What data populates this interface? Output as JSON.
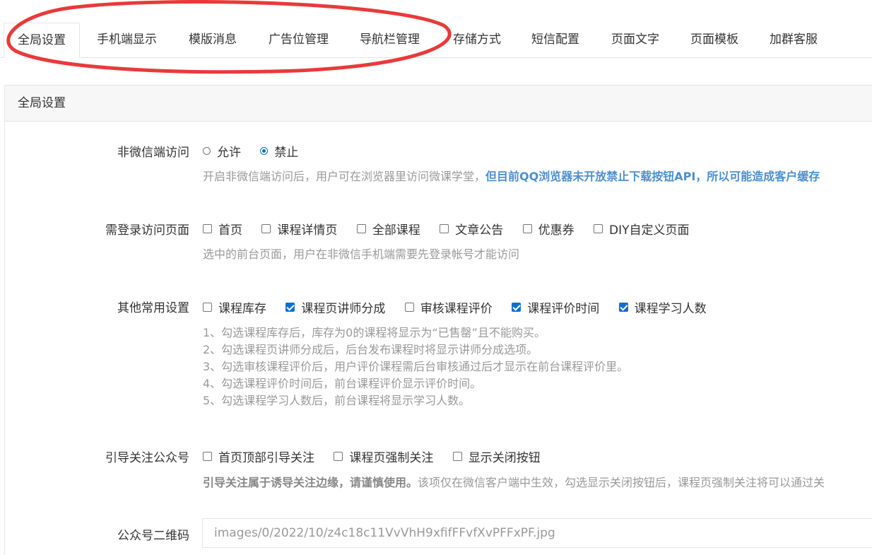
{
  "tabs": [
    {
      "label": "全局设置",
      "active": true
    },
    {
      "label": "手机端显示"
    },
    {
      "label": "模版消息"
    },
    {
      "label": "广告位管理"
    },
    {
      "label": "导航栏管理"
    },
    {
      "label": "存储方式"
    },
    {
      "label": "短信配置"
    },
    {
      "label": "页面文字"
    },
    {
      "label": "页面模板"
    },
    {
      "label": "加群客服"
    }
  ],
  "panel": {
    "title": "全局设置"
  },
  "nonwechat": {
    "label": "非微信端访问",
    "options": [
      {
        "label": "允许",
        "checked": false
      },
      {
        "label": "禁止",
        "checked": true
      }
    ],
    "help_plain": "开启非微信端访问后，用户可在浏览器里访问微课学堂，",
    "help_highlight": "但目前QQ浏览器未开放禁止下载按钮API，所以可能造成客户缓存"
  },
  "login_pages": {
    "label": "需登录访问页面",
    "options": [
      {
        "label": "首页",
        "checked": false
      },
      {
        "label": "课程详情页",
        "checked": false
      },
      {
        "label": "全部课程",
        "checked": false
      },
      {
        "label": "文章公告",
        "checked": false
      },
      {
        "label": "优惠券",
        "checked": false
      },
      {
        "label": "DIY自定义页面",
        "checked": false
      }
    ],
    "help": "选中的前台页面，用户在非微信手机端需要先登录帐号才能访问"
  },
  "other_settings": {
    "label": "其他常用设置",
    "options": [
      {
        "label": "课程库存",
        "checked": false
      },
      {
        "label": "课程页讲师分成",
        "checked": true
      },
      {
        "label": "审核课程评价",
        "checked": false
      },
      {
        "label": "课程评价时间",
        "checked": true
      },
      {
        "label": "课程学习人数",
        "checked": true
      }
    ],
    "help_lines": [
      "1、勾选课程库存后，库存为0的课程将显示为“已售罄”且不能购买。",
      "2、勾选课程页讲师分成后，后台发布课程时将显示讲师分成选项。",
      "3、勾选审核课程评价后，用户评价课程需后台审核通过后才显示在前台课程评价里。",
      "4、勾选课程评价时间后，前台课程评价显示评价时间。",
      "5、勾选课程学习人数后，前台课程将显示学习人数。"
    ]
  },
  "follow": {
    "label": "引导关注公众号",
    "options": [
      {
        "label": "首页顶部引导关注",
        "checked": false
      },
      {
        "label": "课程页强制关注",
        "checked": false
      },
      {
        "label": "显示关闭按钮",
        "checked": false
      }
    ],
    "help_bold": "引导关注属于诱导关注边缘，请谨慎使用。",
    "help_plain": "该项仅在微信客户端中生效，勾选显示关闭按钮后，课程页强制关注将可以通过关"
  },
  "qrcode": {
    "label": "公众号二维码",
    "value": "images/0/2022/10/z4c18c11VvVhH9xfifFFvfXvPFFxPF.jpg"
  },
  "colors": {
    "accent": "#0b6fd6",
    "highlight_text": "#4a8fd1",
    "annotation": "#e83a3a"
  }
}
